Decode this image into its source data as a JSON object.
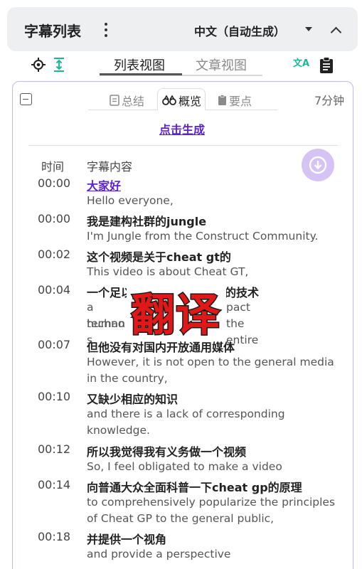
{
  "header": {
    "title": "字幕列表",
    "language": "中文（自动生成）"
  },
  "toolbar": {
    "tab_list": "列表视图",
    "tab_article": "文章视图",
    "translate_glyph": "文A"
  },
  "panel": {
    "subtabs": {
      "summary": "总结",
      "overview": "概览",
      "keypoints": "要点"
    },
    "duration": "7分钟",
    "generate_label": "点击生成",
    "columns": {
      "time": "时间",
      "content": "字幕内容"
    },
    "rows": [
      {
        "time": "00:00",
        "zh": "大家好",
        "en": "Hello everyone,"
      },
      {
        "time": "00:00",
        "zh": "我是建构社群的jungle",
        "en": "I'm Jungle from the Construct Community."
      },
      {
        "time": "00:02",
        "zh": "这个视频是关于cheat gt的",
        "en": "This video is about Cheat GT,"
      },
      {
        "time": "00:04",
        "zh": "一个足以",
        "zh_right": "会的技术",
        "en": "a techno",
        "en_right": "pact the entire",
        "en2": "human s"
      },
      {
        "time": "00:07",
        "zh": "但他没有对国内开放通用媒体",
        "en": "However, it is not open to the general media in the country,"
      },
      {
        "time": "00:10",
        "zh": "又缺少相应的知识",
        "en": "and there is a lack of corresponding knowledge."
      },
      {
        "time": "00:12",
        "zh": "所以我觉得我有义务做一个视频",
        "en": "So, I feel obligated to make a video"
      },
      {
        "time": "00:14",
        "zh": "向普通大众全面科普一下cheat gp的原理",
        "en": "to comprehensively popularize the principles of Cheat GP to the general public,"
      },
      {
        "time": "00:18",
        "zh": "并提供一个视角",
        "en": "and provide a perspective"
      }
    ]
  },
  "watermark": {
    "text": "翻译"
  }
}
